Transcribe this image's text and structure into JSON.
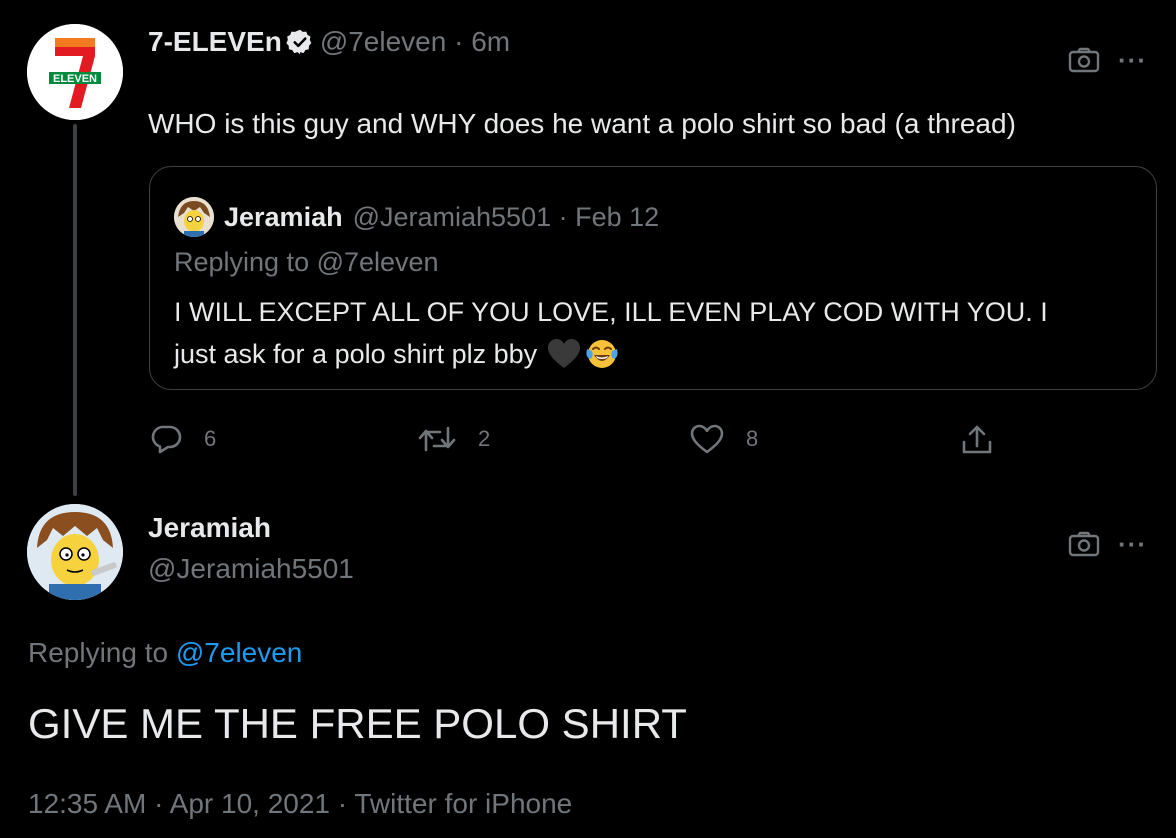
{
  "original_tweet": {
    "display_name": "7-ELEVEn",
    "handle": "@7eleven",
    "time_sep": " · ",
    "time": "6m",
    "text": "WHO is this guy and WHY does he want a polo shirt so bad (a thread)",
    "avatar_icon": "seven-eleven-logo",
    "quote": {
      "display_name": "Jeramiah",
      "handle": "@Jeramiah5501",
      "date_sep": " · ",
      "date": "Feb 12",
      "replying_label": "Replying to @7eleven",
      "body_line1": "I WILL EXCEPT ALL OF YOU LOVE, ILL EVEN PLAY COD WITH YOU. I",
      "body_line2": "just ask for a polo shirt plz bby",
      "emojis": [
        "black-heart",
        "tears-of-joy"
      ]
    },
    "actions": {
      "replies": "6",
      "retweets": "2",
      "likes": "8"
    }
  },
  "reply_tweet": {
    "display_name": "Jeramiah",
    "handle": "@Jeramiah5501",
    "replying_prefix": "Replying to ",
    "replying_mention": "@7eleven",
    "text": "GIVE ME THE FREE POLO SHIRT",
    "meta": "12:35 AM · Apr 10, 2021 · Twitter for iPhone"
  },
  "colors": {
    "background": "#000000",
    "text": "#e7e9ea",
    "muted": "#71767b",
    "link": "#1d9bf0",
    "border": "#3e4144"
  }
}
